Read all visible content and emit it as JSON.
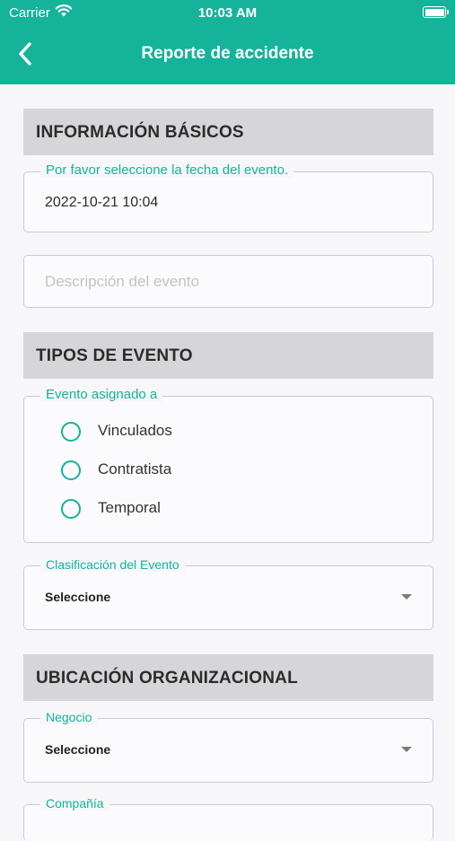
{
  "status": {
    "carrier": "Carrier",
    "time": "10:03 AM"
  },
  "header": {
    "title": "Reporte de accidente"
  },
  "sections": {
    "basic": "INFORMACIÓN BÁSICOS",
    "event_types": "TIPOS DE EVENTO",
    "org": "UBICACIÓN ORGANIZACIONAL"
  },
  "date_field": {
    "label": "Por favor seleccione la fecha del evento.",
    "value": "2022-10-21 10:04"
  },
  "description_field": {
    "placeholder": "Descripción del evento"
  },
  "assigned": {
    "label": "Evento asignado a",
    "options": [
      "Vinculados",
      "Contratista",
      "Temporal"
    ]
  },
  "classification": {
    "label": "Clasificación del Evento",
    "value": "Seleccione"
  },
  "business": {
    "label": "Negocio",
    "value": "Seleccione"
  },
  "company": {
    "label": "Compañía"
  }
}
